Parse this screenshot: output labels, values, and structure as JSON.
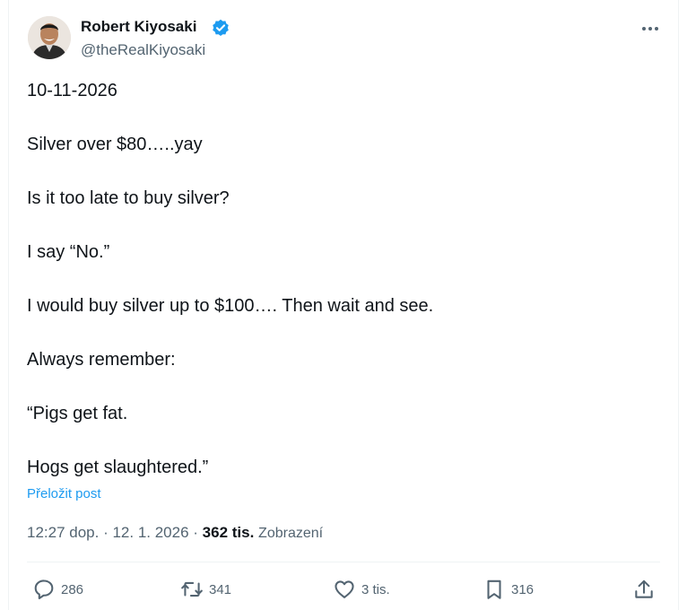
{
  "author": {
    "display_name": "Robert Kiyosaki",
    "handle": "@theRealKiyosaki",
    "verified": true,
    "verified_color": "#1d9bf0"
  },
  "tweet": {
    "lines": [
      "10-11-2026",
      "Silver over $80…..yay",
      "Is it too late to buy silver?",
      "I say “No.”",
      "I would buy silver up to $100…. Then wait and see.",
      "Always remember:",
      "“Pigs get fat.",
      "Hogs get slaughtered.”"
    ],
    "translate_label": "Přeložit post"
  },
  "meta": {
    "time": "12:27 dop.",
    "separator1": " · ",
    "date": "12. 1. 2026",
    "separator2": " · ",
    "views_count": "362 tis.",
    "views_label": "Zobrazení"
  },
  "actions": {
    "replies": "286",
    "reposts": "341",
    "likes": "3 tis.",
    "bookmarks": "316"
  },
  "icons": {
    "more": "more-horizontal-icon",
    "reply": "reply-bubble-icon",
    "repost": "repost-arrows-icon",
    "like": "heart-icon",
    "bookmark": "bookmark-icon",
    "share": "share-upload-icon"
  },
  "colors": {
    "link": "#1d9bf0",
    "secondary_text": "#536471",
    "primary_text": "#0f1419"
  }
}
